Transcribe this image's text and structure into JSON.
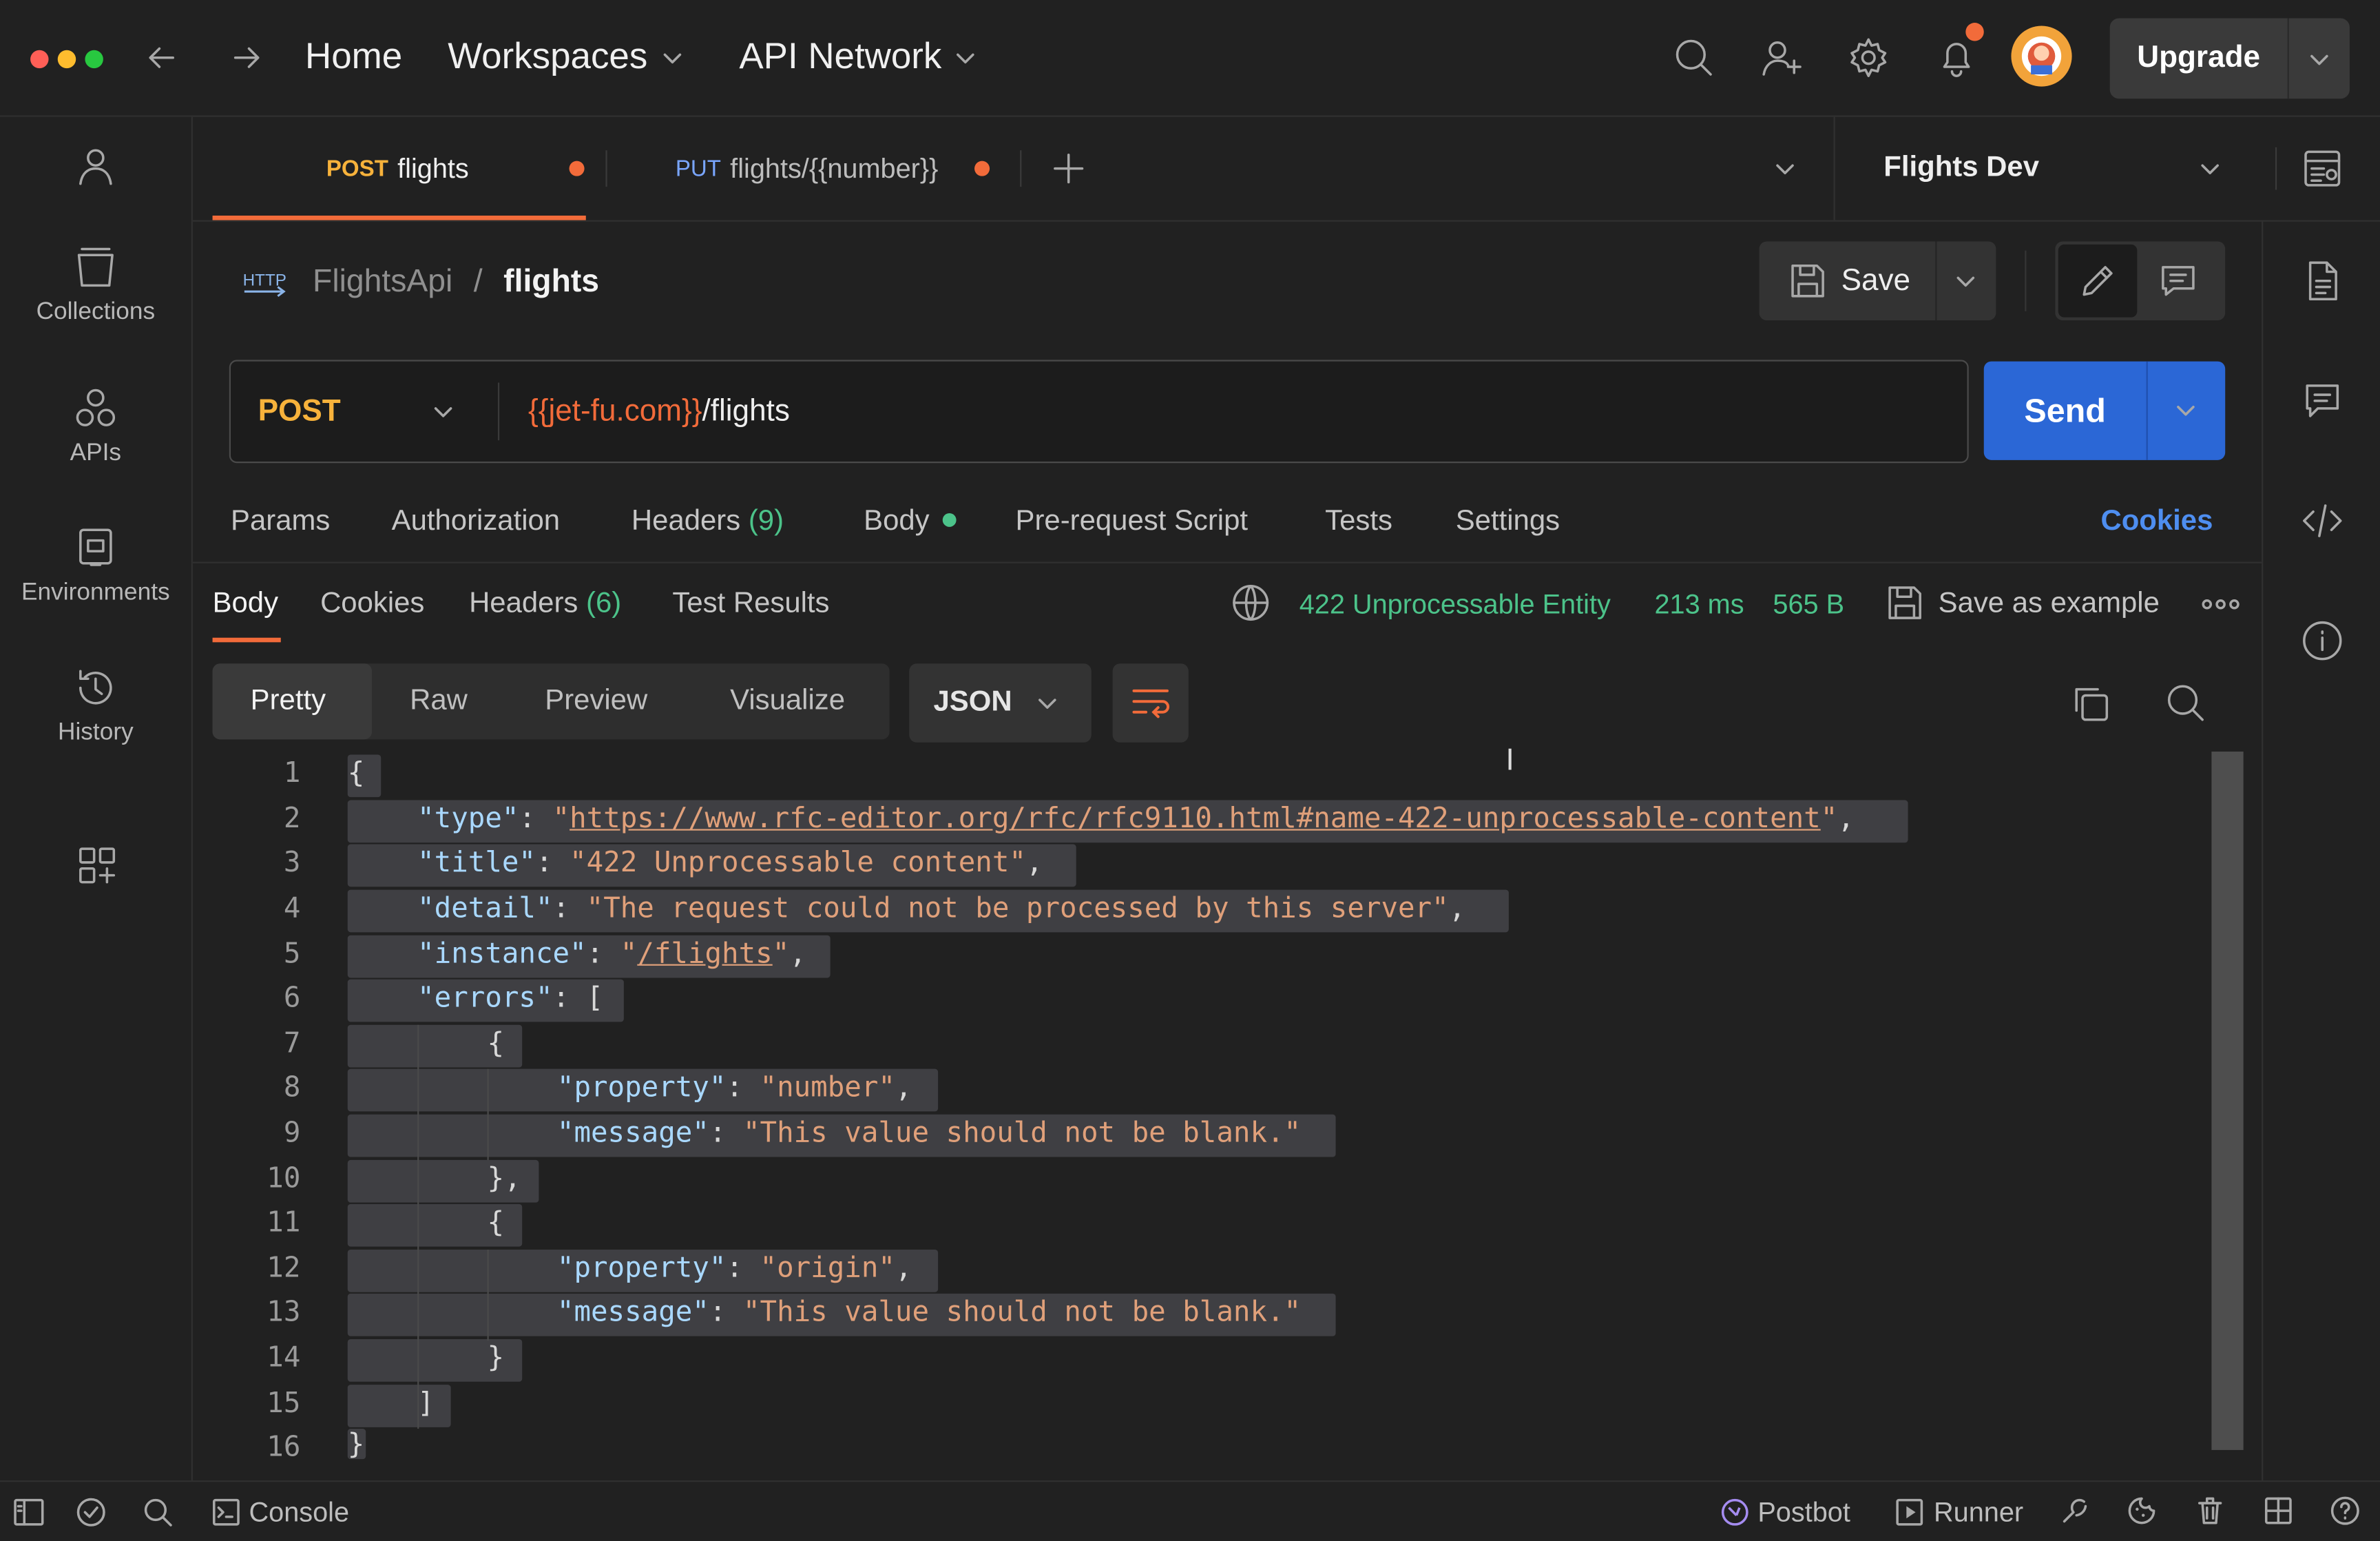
{
  "header": {
    "nav_home": "Home",
    "nav_workspaces": "Workspaces",
    "nav_api_network": "API Network",
    "upgrade_label": "Upgrade"
  },
  "sidebar": {
    "items": [
      {
        "label": "Collections",
        "icon": "collections-icon"
      },
      {
        "label": "APIs",
        "icon": "apis-icon"
      },
      {
        "label": "Environments",
        "icon": "environments-icon"
      },
      {
        "label": "History",
        "icon": "history-icon"
      }
    ]
  },
  "tabs": [
    {
      "method": "POST",
      "name": "flights",
      "active": true
    },
    {
      "method": "PUT",
      "name": "flights/{{number}}",
      "active": false
    }
  ],
  "environment": {
    "selected": "Flights Dev"
  },
  "request": {
    "breadcrumb_parent": "FlightsApi",
    "breadcrumb_sep": "/",
    "breadcrumb_current": "flights",
    "http_badge": "HTTP",
    "save_label": "Save",
    "method": "POST",
    "url_variable": "{{jet-fu.com}}",
    "url_path": "/flights",
    "send_label": "Send",
    "tabs": {
      "params": "Params",
      "authorization": "Authorization",
      "headers": "Headers",
      "headers_count": "(9)",
      "body": "Body",
      "pre_request": "Pre-request Script",
      "tests": "Tests",
      "settings": "Settings",
      "cookies": "Cookies"
    }
  },
  "response": {
    "tabs": {
      "body": "Body",
      "cookies": "Cookies",
      "headers": "Headers",
      "headers_count": "(6)",
      "test_results": "Test Results"
    },
    "status": "422 Unprocessable Entity",
    "time": "213 ms",
    "size": "565 B",
    "save_example": "Save as example",
    "views": {
      "pretty": "Pretty",
      "raw": "Raw",
      "preview": "Preview",
      "visualize": "Visualize"
    },
    "format": "JSON",
    "line_numbers": [
      "1",
      "2",
      "3",
      "4",
      "5",
      "6",
      "7",
      "8",
      "9",
      "10",
      "11",
      "12",
      "13",
      "14",
      "15",
      "16"
    ],
    "json": {
      "open_brace": "{",
      "type_key": "\"type\"",
      "type_value": "https://www.rfc-editor.org/rfc/rfc9110.html#name-422-unprocessable-content",
      "title_key": "\"title\"",
      "title_value": "\"422 Unprocessable content\"",
      "detail_key": "\"detail\"",
      "detail_value": "\"The request could not be processed by this server\"",
      "instance_key": "\"instance\"",
      "instance_value": "/flights",
      "errors_key": "\"errors\"",
      "errors": [
        {
          "property_key": "\"property\"",
          "property_value": "\"number\"",
          "message_key": "\"message\"",
          "message_value": "\"This value should not be blank.\""
        },
        {
          "property_key": "\"property\"",
          "property_value": "\"origin\"",
          "message_key": "\"message\"",
          "message_value": "\"This value should not be blank.\""
        }
      ]
    }
  },
  "bottom": {
    "console": "Console",
    "postbot": "Postbot",
    "runner": "Runner"
  },
  "colors": {
    "accent_blue": "#2b67d6",
    "post_method": "#f7b23b",
    "status_green": "#4cc38a",
    "unsaved_dot": "#f26b3a"
  }
}
